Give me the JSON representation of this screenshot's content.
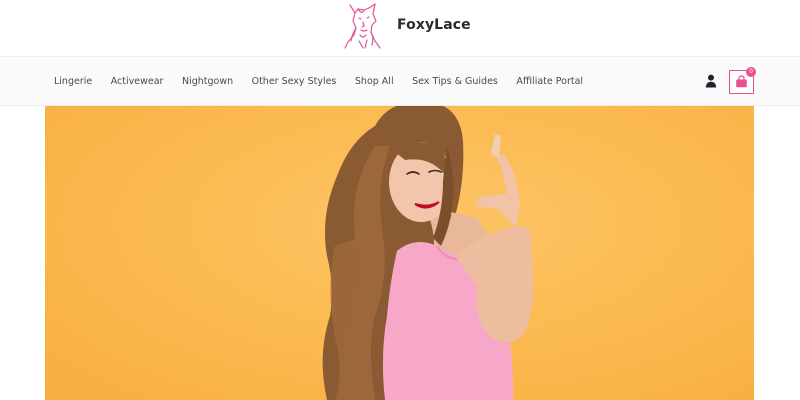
{
  "brand": {
    "name": "FoxyLace",
    "logo_icon": "fox-woman-logo-icon",
    "accent_color": "#e8508f"
  },
  "nav": {
    "items": [
      {
        "label": "Lingerie"
      },
      {
        "label": "Activewear"
      },
      {
        "label": "Nightgown"
      },
      {
        "label": "Other Sexy Styles"
      },
      {
        "label": "Shop All"
      },
      {
        "label": "Sex Tips & Guides"
      },
      {
        "label": "Affiliate Portal"
      }
    ]
  },
  "header_actions": {
    "account_icon": "user-icon",
    "cart_icon": "shopping-bag-icon",
    "cart_count": "0"
  },
  "hero": {
    "background_color": "#fbb94e",
    "image": "woman-in-pink-top-posing-hero-image"
  }
}
